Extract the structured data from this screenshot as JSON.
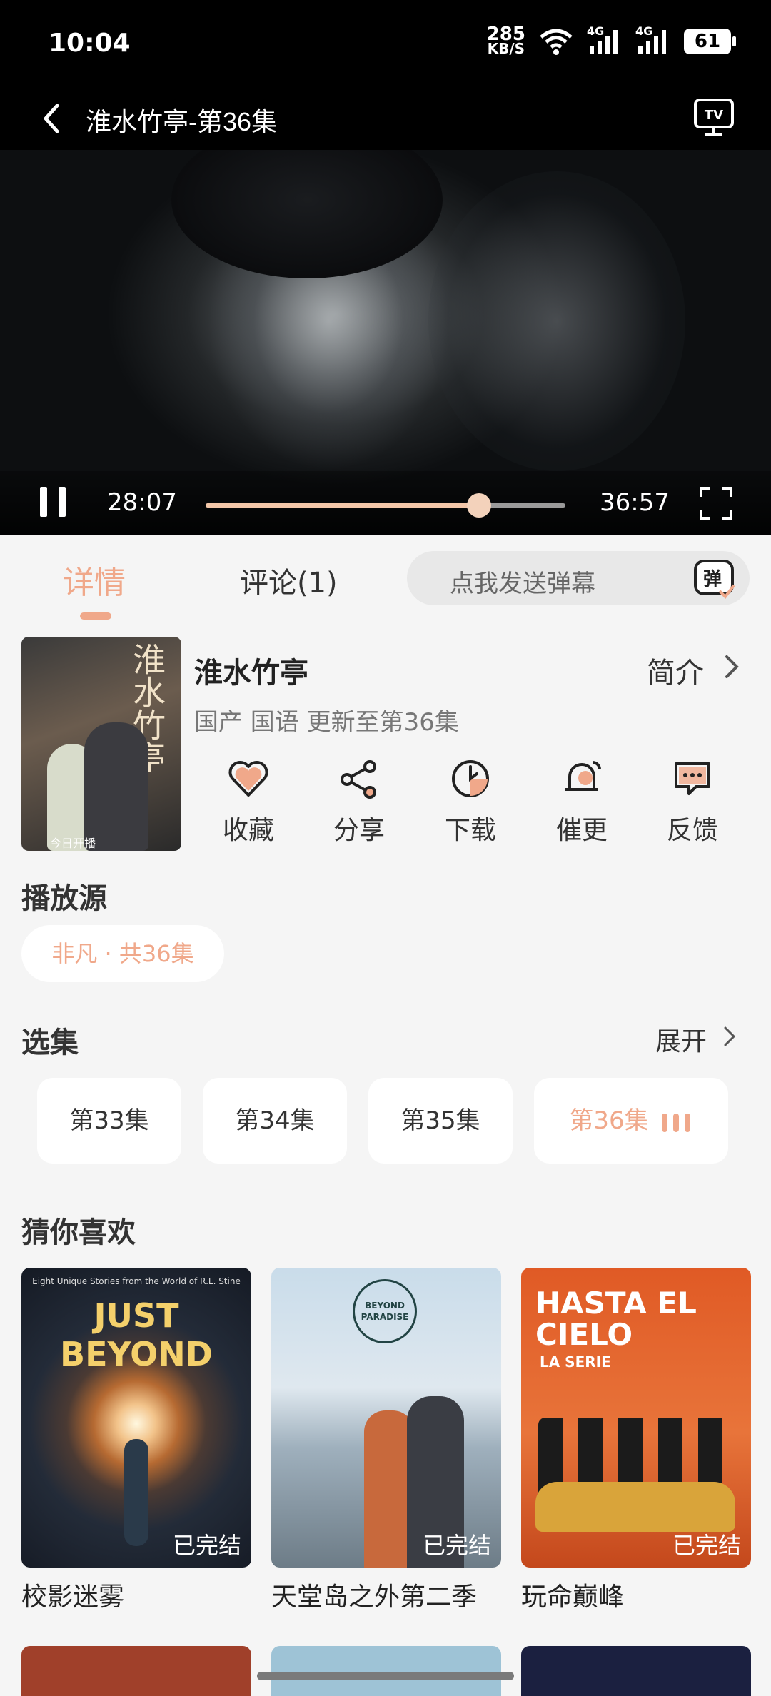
{
  "status_bar": {
    "time": "10:04",
    "net_speed_value": "285",
    "net_speed_unit": "KB/S",
    "network_1": "4G",
    "network_2": "4G",
    "battery": "61"
  },
  "title_bar": {
    "title": "淮水竹亭-第36集"
  },
  "player": {
    "current_time": "28:07",
    "total_time": "36:57",
    "progress": 0.76,
    "state": "playing"
  },
  "tabs": {
    "details": "详情",
    "comments": "评论(1)",
    "danmaku_placeholder": "点我发送弹幕",
    "danmaku_icon_text": "弹"
  },
  "show": {
    "title": "淮水竹亭",
    "intro": "简介",
    "meta": "国产 国语 更新至第36集",
    "poster_text": "淮水竹亭",
    "poster_badge": "今日开播"
  },
  "actions": [
    {
      "label": "收藏",
      "icon": "heart-icon"
    },
    {
      "label": "分享",
      "icon": "share-icon"
    },
    {
      "label": "下载",
      "icon": "download-icon"
    },
    {
      "label": "催更",
      "icon": "bell-icon"
    },
    {
      "label": "反馈",
      "icon": "feedback-icon"
    }
  ],
  "source": {
    "title": "播放源",
    "chip": "非凡 · 共36集"
  },
  "episodes": {
    "title": "选集",
    "expand": "展开",
    "items": [
      "第33集",
      "第34集",
      "第35集",
      "第36集"
    ],
    "active_index": 3
  },
  "recommend": {
    "title": "猜你喜欢",
    "items": [
      {
        "name": "校影迷雾",
        "badge": "已完结",
        "poster_title": "JUST BEYOND",
        "poster_tag": "Eight Unique Stories from the World of R.L. Stine"
      },
      {
        "name": "天堂岛之外第二季",
        "badge": "已完结",
        "poster_title": "BEYOND PARADISE"
      },
      {
        "name": "玩命巅峰",
        "badge": "已完结",
        "poster_title": "HASTA EL CIELO",
        "poster_sub": "LA SERIE"
      }
    ]
  },
  "colors": {
    "accent": "#f0a88a",
    "background": "#f5f5f5",
    "top_bar": "#000000"
  }
}
